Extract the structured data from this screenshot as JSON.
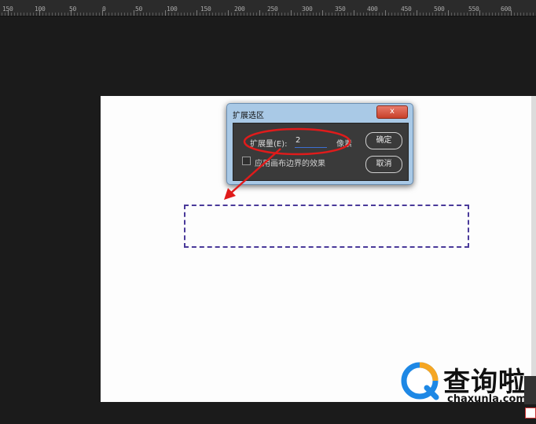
{
  "ruler": {
    "labels": [
      "150",
      "100",
      "50",
      "0",
      "50",
      "100",
      "150",
      "200",
      "250",
      "300",
      "350",
      "400",
      "450",
      "500",
      "550",
      "600"
    ]
  },
  "dialog": {
    "title": "扩展选区",
    "close_label": "x",
    "expand_label": "扩展量(E):",
    "expand_value": "2",
    "unit": "像素",
    "apply_canvas_label": "应用画布边界的效果",
    "ok_label": "确定",
    "cancel_label": "取消"
  },
  "watermark": {
    "brand": "查询啦",
    "url": "chaxunla.com"
  },
  "colors": {
    "annotation": "#e01b1b",
    "selection": "#4a3a9a",
    "dialog_frame": "#a9c9e6"
  }
}
